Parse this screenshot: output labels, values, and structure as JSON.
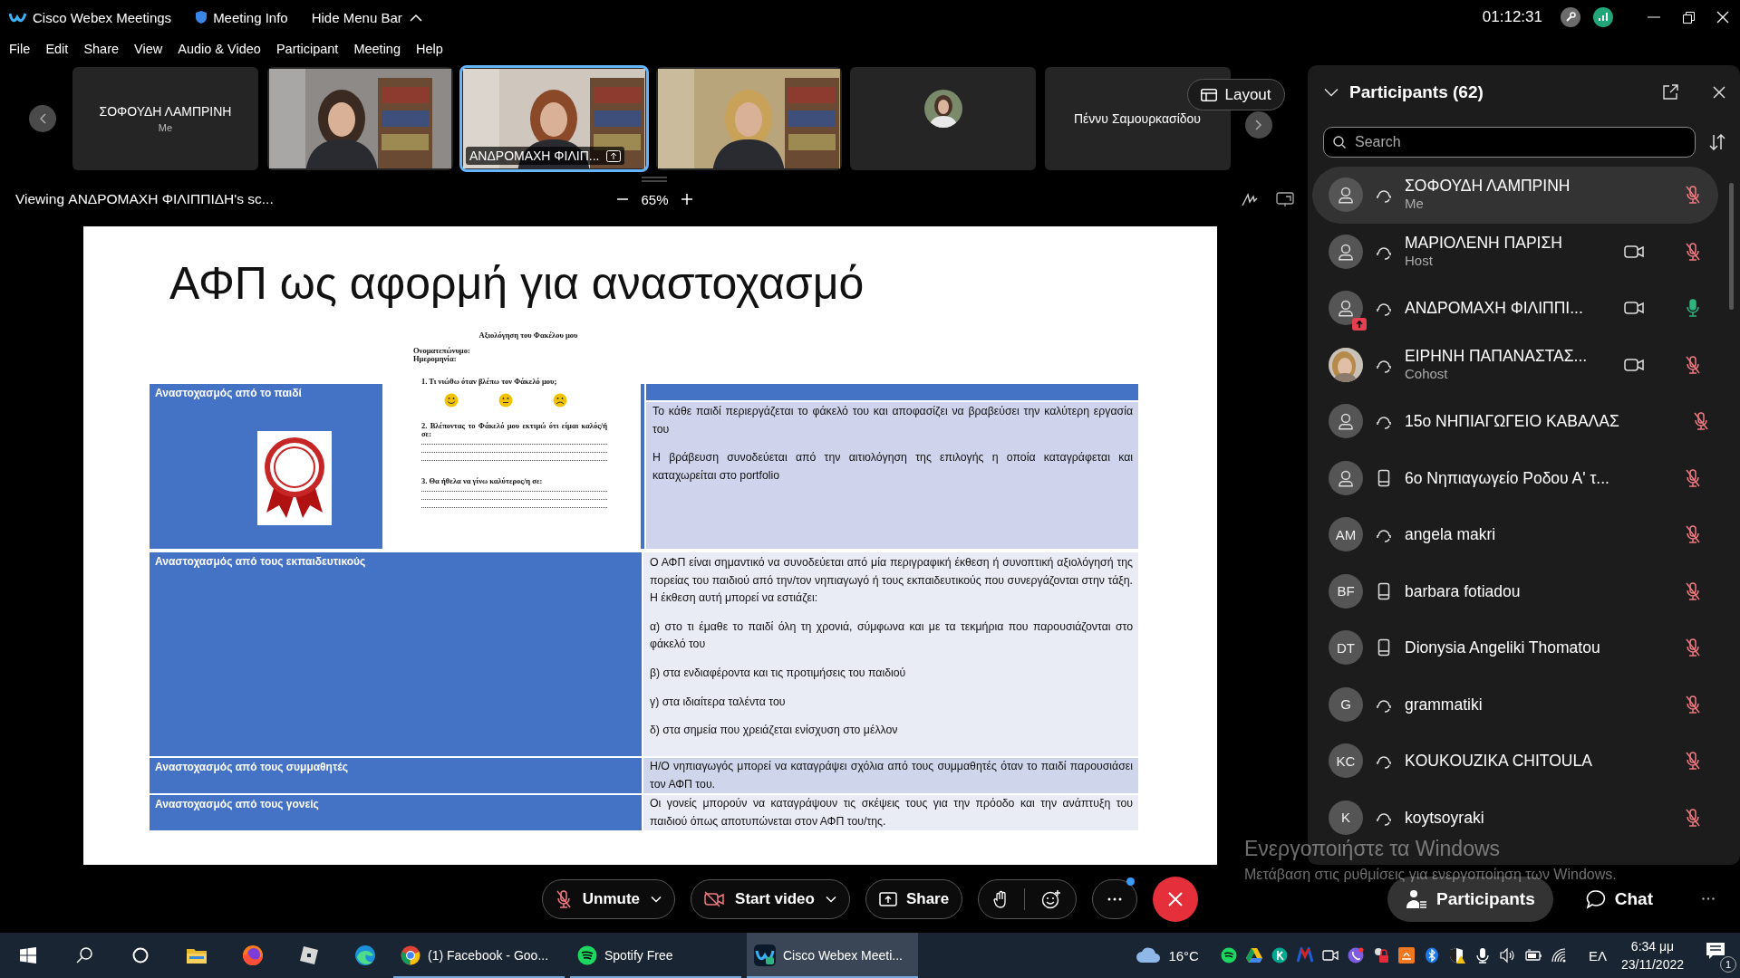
{
  "title_bar": {
    "app_name": "Cisco Webex Meetings",
    "meeting_info": "Meeting Info",
    "hide_menu": "Hide Menu Bar",
    "timer": "01:12:31"
  },
  "menu": [
    "File",
    "Edit",
    "Share",
    "View",
    "Audio & Video",
    "Participant",
    "Meeting",
    "Help"
  ],
  "filmstrip": {
    "tiles": [
      {
        "kind": "name",
        "name": "ΣΟΦΟΥΔΗ ΛΑΜΠΡΙΝΗ",
        "subtitle": "Me",
        "selected": false
      },
      {
        "kind": "video",
        "selected": false
      },
      {
        "kind": "video",
        "label": "ΑΝΔΡΟΜΑΧΗ ΦΙΛΙΠ...",
        "sharing": true,
        "selected": true
      },
      {
        "kind": "video",
        "selected": false
      },
      {
        "kind": "avatar",
        "selected": false
      },
      {
        "kind": "name",
        "name": "Πέννυ Σαμουρκασίδου",
        "selected": false
      }
    ],
    "layout_button": "Layout"
  },
  "share_bar": {
    "viewing": "Viewing ΑΝΔΡΟΜΑΧΗ ΦΙΛΙΠΠΙΔΗ's sc...",
    "zoom": "65%"
  },
  "slide": {
    "title": "ΑΦΠ ως αφορμή για αναστοχασμό",
    "worksheet": {
      "title": "Αξιολόγηση του Φακέλου μου",
      "fields": [
        "Ονοματεπώνυμο:",
        "Ημερομηνία:"
      ],
      "questions": [
        {
          "text": "1. Τι νιώθω όταν βλέπω τον Φάκελό μου;",
          "kind": "faces"
        },
        {
          "text": "2. Βλέποντας το Φάκελό μου εκτιμώ ότι είμαι καλός/ή σε:",
          "kind": "lines"
        },
        {
          "text": "3. Θα ήθελα να γίνω καλύτερος/η σε:",
          "kind": "lines"
        }
      ]
    },
    "rows": [
      {
        "kind": "split",
        "header": "Αναστοχασμός από το παιδί",
        "paragraphs": [
          "Το κάθε παιδί περιεργάζεται το φάκελό του και αποφασίζει να βραβεύσει την καλύτερη εργασία του",
          "Η βράβευση συνοδεύεται από την αιτιολόγηση της επιλογής η οποία καταγράφεται και καταχωρείται στο portfolio"
        ]
      },
      {
        "kind": "full",
        "header": "Αναστοχασμός από τους εκπαιδευτικούς",
        "paragraphs": [
          "Ο ΑΦΠ είναι σημαντικό να συνοδεύεται από μία περιγραφική έκθεση ή συνοπτική αξιολόγησή της πορείας του παιδιού από την/τον νηπιαγωγό ή τους εκπαιδευτικούς που συνεργάζονται στην τάξη. Η έκθεση αυτή μπορεί να εστιάζει:",
          " α) στο τι έμαθε το παιδί όλη τη χρονιά, σύμφωνα και με τα τεκμήρια που παρουσιάζονται στο φάκελό του",
          "β) στα ενδιαφέροντα και τις προτιμήσεις του παιδιού",
          "γ) στα ιδιαίτερα ταλέντα του",
          "δ) στα σημεία που χρειάζεται ενίσχυση στο μέλλον"
        ]
      },
      {
        "kind": "full",
        "header": "Αναστοχασμός από τους συμμαθητές",
        "paragraphs": [
          "Η/Ο νηπιαγωγός μπορεί να καταγράψει σχόλια από τους συμμαθητές όταν το παιδί παρουσιάσει τον ΑΦΠ του."
        ]
      },
      {
        "kind": "full",
        "header": "Αναστοχασμός από τους γονείς",
        "paragraphs": [
          "Οι γονείς μπορούν να καταγράψουν τις σκέψεις τους για την πρόοδο και την ανάπτυξη του παιδιού όπως αποτυπώνεται στον ΑΦΠ του/της."
        ]
      }
    ]
  },
  "participants": {
    "title": "Participants (62)",
    "search_placeholder": "Search",
    "rows": [
      {
        "name": "ΣΟΦΟΥΔΗ ΛΑΜΠΡΙΝΗ",
        "role": "Me",
        "avatar": {
          "kind": "icon"
        },
        "audio": {
          "kind": "headset"
        },
        "video": false,
        "muted": true,
        "sharing": false,
        "selected": true
      },
      {
        "name": "ΜΑΡΙΟΛΕΝΗ ΠΑΡΙΣΗ",
        "role": "Host",
        "avatar": {
          "kind": "icon"
        },
        "audio": {
          "kind": "headset"
        },
        "video": true,
        "muted": true,
        "sharing": false,
        "selected": false
      },
      {
        "name": "ΑΝΔΡΟΜΑΧΗ ΦΙΛΙΠΠΙ...",
        "avatar": {
          "kind": "icon"
        },
        "audio": {
          "kind": "headset"
        },
        "video": true,
        "muted": false,
        "sharing": true,
        "selected": false
      },
      {
        "name": "ΕΙΡΗΝΗ ΠΑΠΑΝΑΣΤΑΣ...",
        "role": "Cohost",
        "audio": {
          "kind": "headset"
        },
        "video": true,
        "muted": true,
        "sharing": false,
        "selected": false
      },
      {
        "name": "15ο ΝΗΠΙΑΓΩΓΕΙΟ ΚΑΒΑΛΑΣ",
        "avatar": {
          "kind": "icon"
        },
        "audio": {
          "kind": "headset"
        },
        "video": false,
        "muted": true,
        "sharing": false,
        "selected": false
      },
      {
        "name": "6ο Νηπιαγωγείο Ροδου Α' τ...",
        "avatar": {
          "kind": "icon"
        },
        "audio": {
          "kind": "phone"
        },
        "video": false,
        "muted": true,
        "sharing": false,
        "selected": false
      },
      {
        "name": "angela makri",
        "avatar": {
          "kind": "initials",
          "text": "AM"
        },
        "audio": {
          "kind": "headset"
        },
        "video": false,
        "muted": true,
        "sharing": false,
        "selected": false
      },
      {
        "name": "barbara fotiadou",
        "avatar": {
          "kind": "initials",
          "text": "BF"
        },
        "audio": {
          "kind": "phone"
        },
        "video": false,
        "muted": true,
        "sharing": false,
        "selected": false
      },
      {
        "name": "Dionysia Angeliki Thomatou",
        "avatar": {
          "kind": "initials",
          "text": "DT"
        },
        "audio": {
          "kind": "phone"
        },
        "video": false,
        "muted": true,
        "sharing": false,
        "selected": false
      },
      {
        "name": "grammatiki",
        "avatar": {
          "kind": "initials",
          "text": "G"
        },
        "audio": {
          "kind": "headset"
        },
        "video": false,
        "muted": true,
        "sharing": false,
        "selected": false
      },
      {
        "name": "KOUKOUZIKA CHITOULA",
        "avatar": {
          "kind": "initials",
          "text": "KC"
        },
        "audio": {
          "kind": "headset"
        },
        "video": false,
        "muted": true,
        "sharing": false,
        "selected": false
      },
      {
        "name": "koytsoyraki",
        "avatar": {
          "kind": "initials",
          "text": "K"
        },
        "audio": {
          "kind": "headset"
        },
        "video": false,
        "muted": true,
        "sharing": false,
        "selected": false
      }
    ]
  },
  "controls": {
    "unmute": "Unmute",
    "start_video": "Start video",
    "share": "Share",
    "participants": "Participants",
    "chat": "Chat"
  },
  "windows_activation": {
    "title": "Ενεργοποιήστε τα Windows",
    "subtitle": "Μετάβαση στις ρυθμίσεις για ενεργοποίηση των Windows."
  },
  "taskbar": {
    "apps": [
      {
        "kind": "start",
        "selected": false
      },
      {
        "kind": "search",
        "selected": false
      },
      {
        "kind": "cortana",
        "selected": false
      },
      {
        "kind": "folder",
        "selected": false
      },
      {
        "kind": "browser-fox",
        "selected": false
      },
      {
        "kind": "app-tile",
        "selected": false
      },
      {
        "kind": "browser-wave",
        "selected": false
      },
      {
        "kind": "browser-ring",
        "label": "(1) Facebook - Goo...",
        "selected": false
      },
      {
        "kind": "music",
        "label": "Spotify Free",
        "selected": false
      },
      {
        "kind": "meeting",
        "label": "Cisco Webex Meeti...",
        "selected": true
      }
    ],
    "weather": "16°C",
    "language": "ΕΛ",
    "time": "6:34 μμ",
    "date": "23/11/2022",
    "notifications": "1"
  }
}
